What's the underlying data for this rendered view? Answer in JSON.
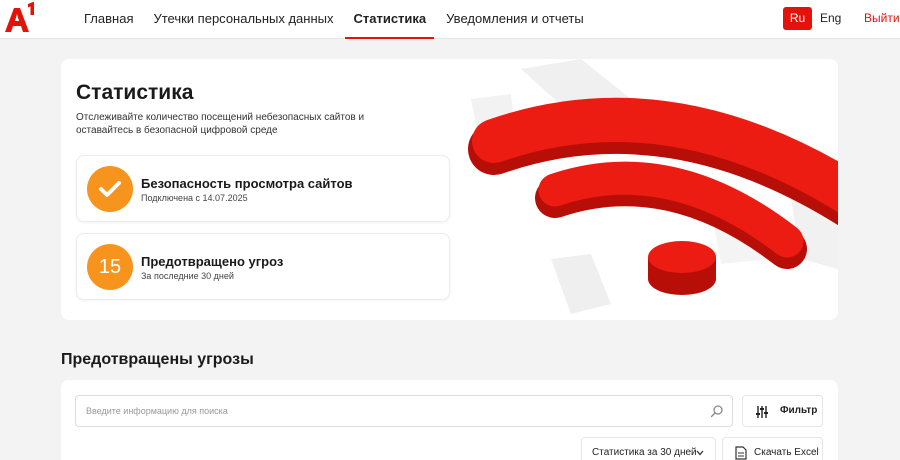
{
  "header": {
    "logo_text": "A1",
    "nav": [
      {
        "label": "Главная"
      },
      {
        "label": "Утечки персональных данных"
      },
      {
        "label": "Статистика",
        "active": true
      },
      {
        "label": "Уведомления и отчеты"
      }
    ],
    "lang_ru": "Ru",
    "lang_en": "Eng",
    "logout": "Выйти"
  },
  "hero": {
    "title": "Статистика",
    "description": "Отслеживайте количество посещений небезопасных сайтов и оставайтесь в безопасной цифровой среде",
    "cards": [
      {
        "icon": "checkmark-icon",
        "title": "Безопасность просмотра сайтов",
        "subtitle": "Подключена с 14.07.2025"
      },
      {
        "value": "15",
        "title": "Предотвращено угроз",
        "subtitle": "За последние 30 дней"
      }
    ]
  },
  "threats": {
    "title": "Предотвращены угрозы",
    "search_placeholder": "Введите информацию для поиска",
    "filter_label": "Фильтр",
    "period_label": "Статистика за 30 дней",
    "excel_label": "Скачать Excel"
  },
  "colors": {
    "brand_red": "#e3120b",
    "accent_orange": "#f7941d",
    "background": "#f3f3f3"
  }
}
